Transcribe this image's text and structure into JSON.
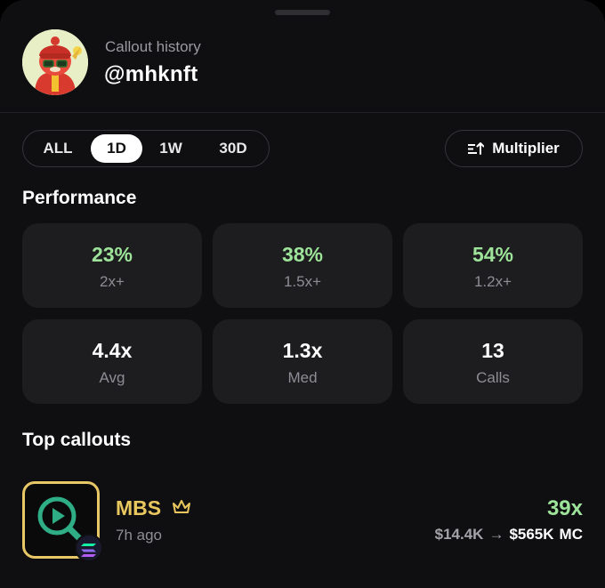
{
  "header": {
    "subtitle": "Callout history",
    "handle": "@mhknft",
    "avatar_icon": "cartoon-avatar"
  },
  "range_tabs": {
    "items": [
      "ALL",
      "1D",
      "1W",
      "30D"
    ],
    "selected": "1D"
  },
  "multiplier_button": {
    "label": "Multiplier",
    "icon": "sort-icon"
  },
  "performance": {
    "title": "Performance",
    "stats": [
      {
        "value": "23%",
        "label": "2x+",
        "color": "#9ee39a"
      },
      {
        "value": "38%",
        "label": "1.5x+",
        "color": "#9ee39a"
      },
      {
        "value": "54%",
        "label": "1.2x+",
        "color": "#9ee39a"
      },
      {
        "value": "4.4x",
        "label": "Avg",
        "color": "#ffffff"
      },
      {
        "value": "1.3x",
        "label": "Med",
        "color": "#ffffff"
      },
      {
        "value": "13",
        "label": "Calls",
        "color": "#ffffff"
      }
    ]
  },
  "top_callouts": {
    "title": "Top callouts",
    "items": [
      {
        "name": "MBS",
        "time": "7h ago",
        "multiplier": "39x",
        "from_mc": "$14.4K",
        "arrow": "→",
        "to_mc": "$565K",
        "unit": "MC",
        "icon": "play-search-icon",
        "chain_icon": "solana-icon",
        "badge_icon": "crown-icon",
        "accent_color": "#e9c75f"
      }
    ]
  }
}
